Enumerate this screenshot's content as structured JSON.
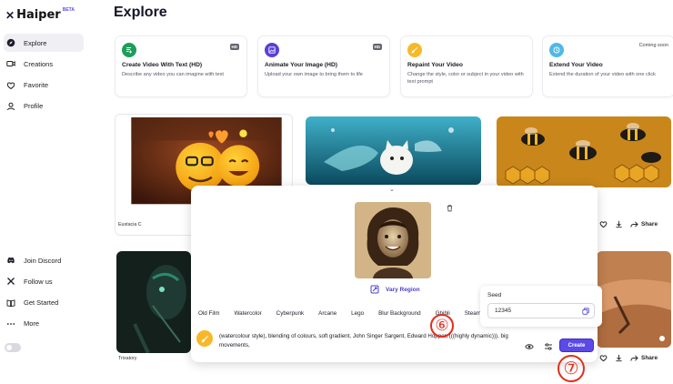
{
  "app": {
    "brand": "Haiper",
    "beta": "BETA"
  },
  "sidebar": {
    "items": [
      {
        "label": "Explore",
        "icon": "compass-icon"
      },
      {
        "label": "Creations",
        "icon": "video-icon"
      },
      {
        "label": "Favorite",
        "icon": "heart-icon"
      },
      {
        "label": "Profile",
        "icon": "user-icon"
      }
    ],
    "bottom": [
      {
        "label": "Join Discord",
        "icon": "discord-icon"
      },
      {
        "label": "Follow us",
        "icon": "x-icon"
      },
      {
        "label": "Get Started",
        "icon": "book-icon"
      },
      {
        "label": "More",
        "icon": "more-icon"
      }
    ]
  },
  "page": {
    "title": "Explore"
  },
  "features": [
    {
      "title": "Create Video With Text (HD)",
      "desc": "Describe any video you can imagine with text",
      "badge": "HD",
      "color": "#1f9d5a"
    },
    {
      "title": "Animate Your Image (HD)",
      "desc": "Upload your own image to bring them to life",
      "badge": "HD",
      "color": "#5b3fd6"
    },
    {
      "title": "Repaint Your Video",
      "desc": "Change the style, color or subject in your video with text prompt",
      "badge": "",
      "color": "#f6b928"
    },
    {
      "title": "Extend Your Video",
      "desc": "Extend the duration of your video with one click",
      "badge": "Coming soon",
      "color": "#4fb8e8"
    }
  ],
  "cards": {
    "caption1": "Eustacia C",
    "caption2": "Trixatory",
    "share": "Share"
  },
  "modal": {
    "vary": "Vary Region",
    "styles": [
      "Old Film",
      "Watercolor",
      "Cyberpunk",
      "Arcane",
      "Lego",
      "Blur Background",
      "Ghibli",
      "Steampunk"
    ],
    "prompt": "(watercolour style), blending of colours, soft gradient, John Singer Sargent, Edward Hopper, (((highly dynamic))), big movements,",
    "create": "Create"
  },
  "seed": {
    "label": "Seed",
    "value": "12345"
  },
  "annotations": {
    "a6": "⑥",
    "a7": "⑦"
  }
}
